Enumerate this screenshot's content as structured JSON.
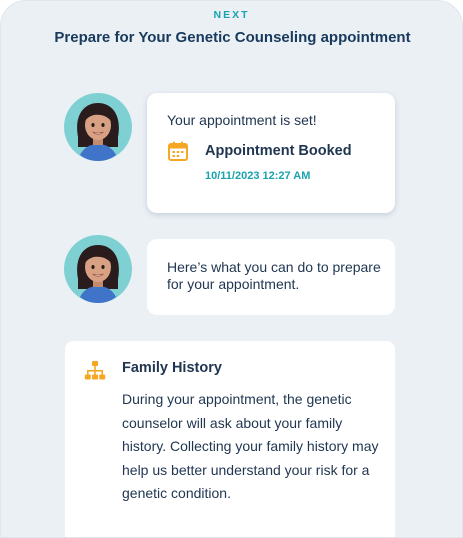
{
  "header": {
    "eyebrow": "NEXT",
    "title": "Prepare for Your Genetic Counseling appointment"
  },
  "messages": [
    {
      "text": "Your appointment is set!",
      "event": {
        "icon": "calendar-icon",
        "title": "Appointment Booked",
        "timestamp": "10/11/2023 12:27 AM"
      }
    },
    {
      "text": "Here’s what you can do to prepare for your appointment."
    }
  ],
  "card": {
    "icon": "family-tree-icon",
    "title": "Family History",
    "body": "During your appointment, the genetic counselor will ask about your family history. Collecting your family history may help us better understand your risk for a genetic condition."
  },
  "colors": {
    "accent_teal": "#1aa3ad",
    "icon_orange": "#f5a623",
    "text_navy": "#1f3550",
    "panel_bg": "#ebf0f5"
  }
}
